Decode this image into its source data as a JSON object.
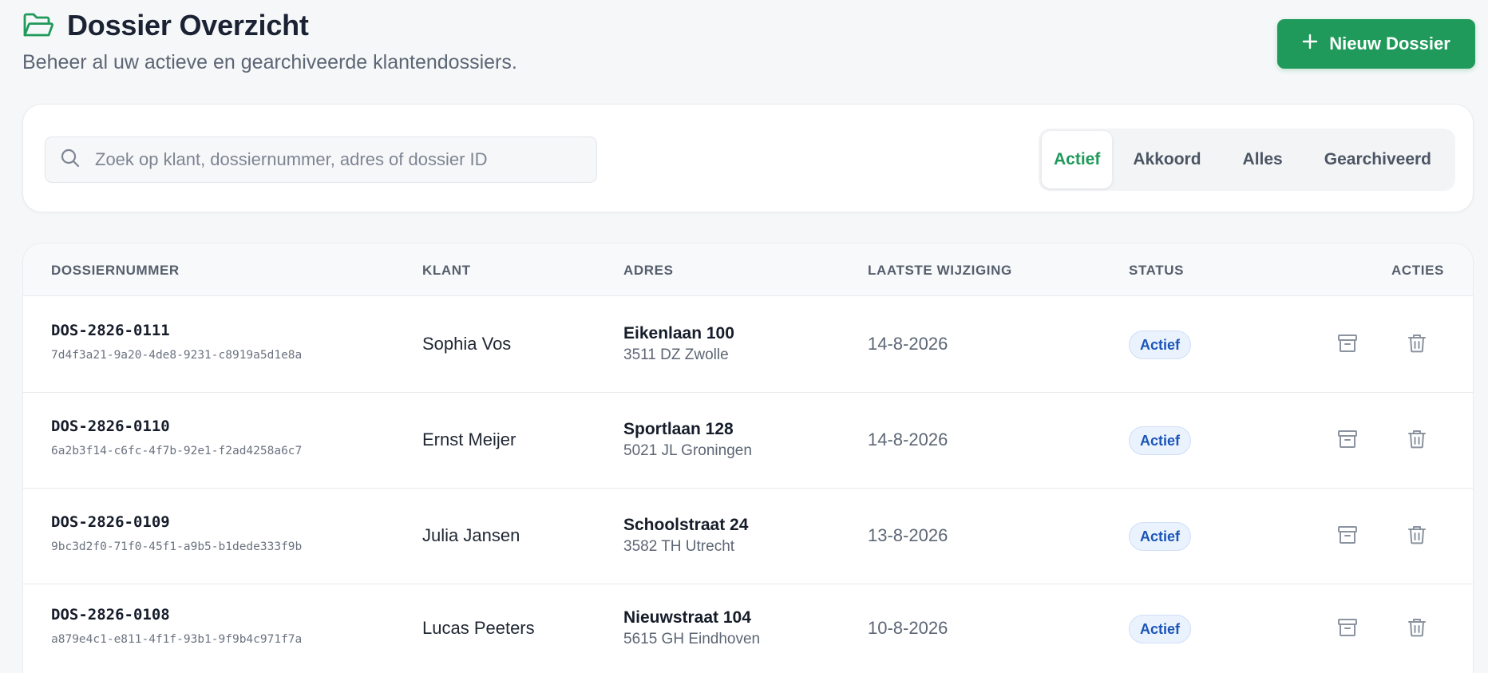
{
  "header": {
    "title": "Dossier Overzicht",
    "subtitle": "Beheer al uw actieve en gearchiveerde klantendossiers.",
    "new_button_label": "Nieuw Dossier",
    "icons": {
      "title": "folder-open-icon",
      "new": "plus-icon"
    }
  },
  "colors": {
    "accent": "#1f9a5a",
    "badge_text": "#1a55b8",
    "badge_bg": "#eaf2fd",
    "icon_muted": "#8a939f"
  },
  "search": {
    "placeholder": "Zoek op klant, dossiernummer, adres of dossier ID",
    "value": "",
    "icon": "search-icon"
  },
  "filter_tabs": [
    {
      "label": "Actief",
      "active": true
    },
    {
      "label": "Akkoord",
      "active": false
    },
    {
      "label": "Alles",
      "active": false
    },
    {
      "label": "Gearchiveerd",
      "active": false
    }
  ],
  "table": {
    "columns": [
      "DOSSIERNUMMER",
      "KLANT",
      "ADRES",
      "LAATSTE WIJZIGING",
      "STATUS",
      "ACTIES"
    ],
    "rows": [
      {
        "dossier_number": "DOS-2826-0111",
        "dossier_id": "7d4f3a21-9a20-4de8-9231-c8919a5d1e8a",
        "client": "Sophia Vos",
        "street": "Eikenlaan 100",
        "city": "3511 DZ Zwolle",
        "last_modified": "14-8-2026",
        "status": "Actief"
      },
      {
        "dossier_number": "DOS-2826-0110",
        "dossier_id": "6a2b3f14-c6fc-4f7b-92e1-f2ad4258a6c7",
        "client": "Ernst Meijer",
        "street": "Sportlaan 128",
        "city": "5021 JL Groningen",
        "last_modified": "14-8-2026",
        "status": "Actief"
      },
      {
        "dossier_number": "DOS-2826-0109",
        "dossier_id": "9bc3d2f0-71f0-45f1-a9b5-b1dede333f9b",
        "client": "Julia Jansen",
        "street": "Schoolstraat 24",
        "city": "3582 TH Utrecht",
        "last_modified": "13-8-2026",
        "status": "Actief"
      },
      {
        "dossier_number": "DOS-2826-0108",
        "dossier_id": "a879e4c1-e811-4f1f-93b1-9f9b4c971f7a",
        "client": "Lucas Peeters",
        "street": "Nieuwstraat 104",
        "city": "5615 GH Eindhoven",
        "last_modified": "10-8-2026",
        "status": "Actief"
      }
    ],
    "row_action_icons": [
      "archive-icon",
      "trash-icon"
    ]
  }
}
